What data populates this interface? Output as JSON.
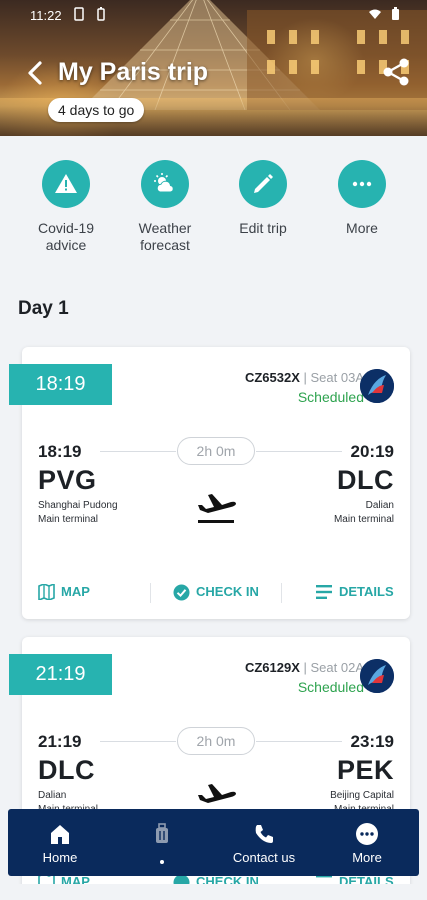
{
  "status_bar": {
    "time": "11:22"
  },
  "header": {
    "title": "My Paris trip",
    "countdown": "4 days to go"
  },
  "actions": [
    {
      "label_1": "Covid-19",
      "label_2": "advice",
      "icon": "warning-icon"
    },
    {
      "label_1": "Weather",
      "label_2": "forecast",
      "icon": "weather-icon"
    },
    {
      "label_1": "Edit trip",
      "label_2": "",
      "icon": "pencil-icon"
    },
    {
      "label_1": "More",
      "label_2": "",
      "icon": "more-dots-icon"
    }
  ],
  "day_label": "Day 1",
  "flights": [
    {
      "tag_time": "18:19",
      "flight_no": "CZ6532X",
      "seat": "| Seat 03A",
      "status": "Scheduled",
      "dep_time": "18:19",
      "arr_time": "20:19",
      "duration": "2h 0m",
      "dep_code": "PVG",
      "arr_code": "DLC",
      "dep_city": "Shanghai Pudong",
      "dep_terminal": "Main terminal",
      "arr_city": "Dalian",
      "arr_terminal": "Main terminal",
      "map_label": "MAP",
      "checkin_label": "CHECK IN",
      "details_label": "DETAILS"
    },
    {
      "tag_time": "21:19",
      "flight_no": "CZ6129X",
      "seat": "| Seat 02A",
      "status": "Scheduled",
      "dep_time": "21:19",
      "arr_time": "23:19",
      "duration": "2h 0m",
      "dep_code": "DLC",
      "arr_code": "PEK",
      "dep_city": "Dalian",
      "dep_terminal": "Main terminal",
      "arr_city": "Beijing Capital",
      "arr_terminal": "Main terminal",
      "map_label": "MAP",
      "checkin_label": "CHECK IN",
      "details_label": "DETAILS"
    }
  ],
  "bottom_nav": [
    {
      "label": "Home",
      "icon": "home-icon"
    },
    {
      "label": "",
      "icon": "luggage-icon"
    },
    {
      "label": "Contact us",
      "icon": "phone-icon"
    },
    {
      "label": "More",
      "icon": "more-dots-icon"
    }
  ],
  "colors": {
    "accent": "#27b3b0",
    "status_green": "#2ea34f",
    "nav_bg": "#0a2a5c"
  }
}
